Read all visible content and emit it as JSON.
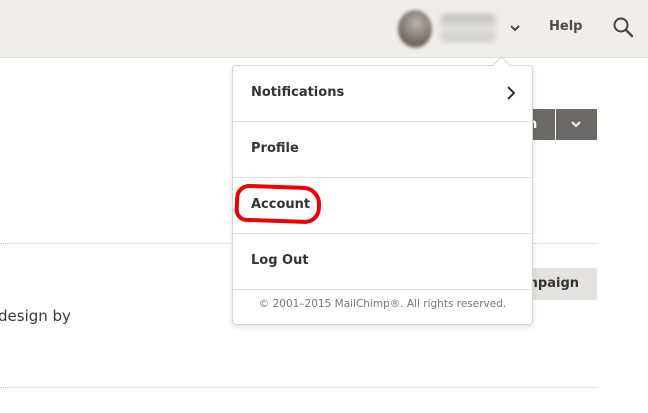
{
  "header": {
    "help_label": "Help",
    "icons": [
      "avatar",
      "chevron-down-icon",
      "search-icon"
    ]
  },
  "toolbar": {
    "split_button_label": "n"
  },
  "content": {
    "create_campaign_label": "mpaign",
    "body_text": "design by"
  },
  "user_menu": {
    "items": [
      {
        "label": "Notifications",
        "has_submenu": true
      },
      {
        "label": "Profile"
      },
      {
        "label": "Account"
      },
      {
        "label": "Log Out"
      }
    ],
    "copyright": "© 2001–2015 MailChimp®. All rights reserved."
  },
  "colors": {
    "header_bg": "#efeeea",
    "button_dark": "#6b6a68",
    "button_light": "#e3e2de",
    "highlight": "#ee0000"
  }
}
